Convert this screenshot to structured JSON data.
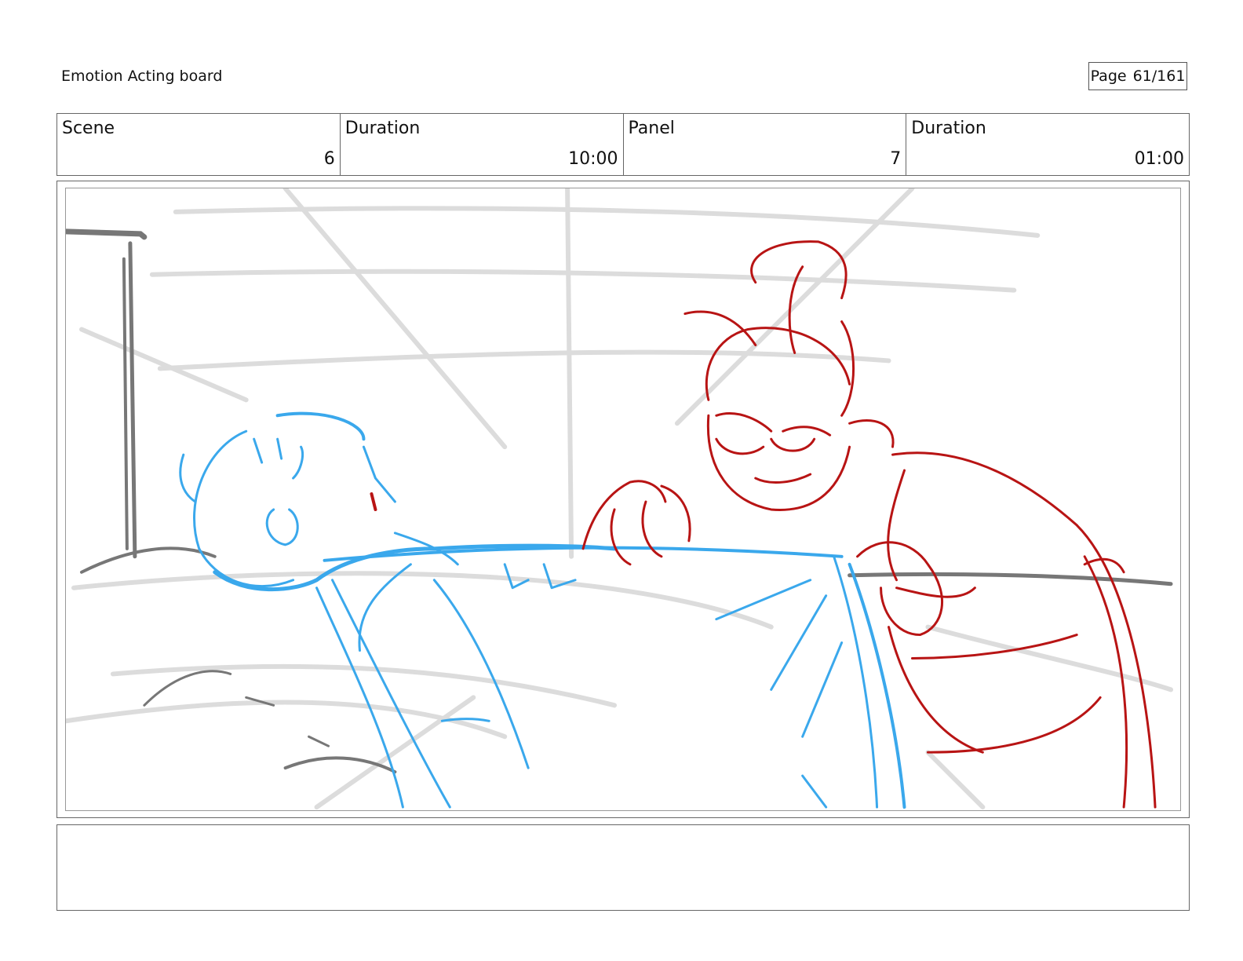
{
  "header": {
    "title": "Emotion Acting board",
    "page_label": "Page",
    "page_number": "61/161"
  },
  "info": {
    "scene_label": "Scene",
    "scene_value": "6",
    "scene_duration_label": "Duration",
    "scene_duration_value": "10:00",
    "panel_label": "Panel",
    "panel_value": "7",
    "panel_duration_label": "Duration",
    "panel_duration_value": "01:00"
  },
  "notes": {
    "text": ""
  },
  "colors": {
    "background_lines": "#dcdcdc",
    "structure_lines": "#777777",
    "patient_lines": "#3aa8ec",
    "doctor_lines": "#b81414"
  }
}
